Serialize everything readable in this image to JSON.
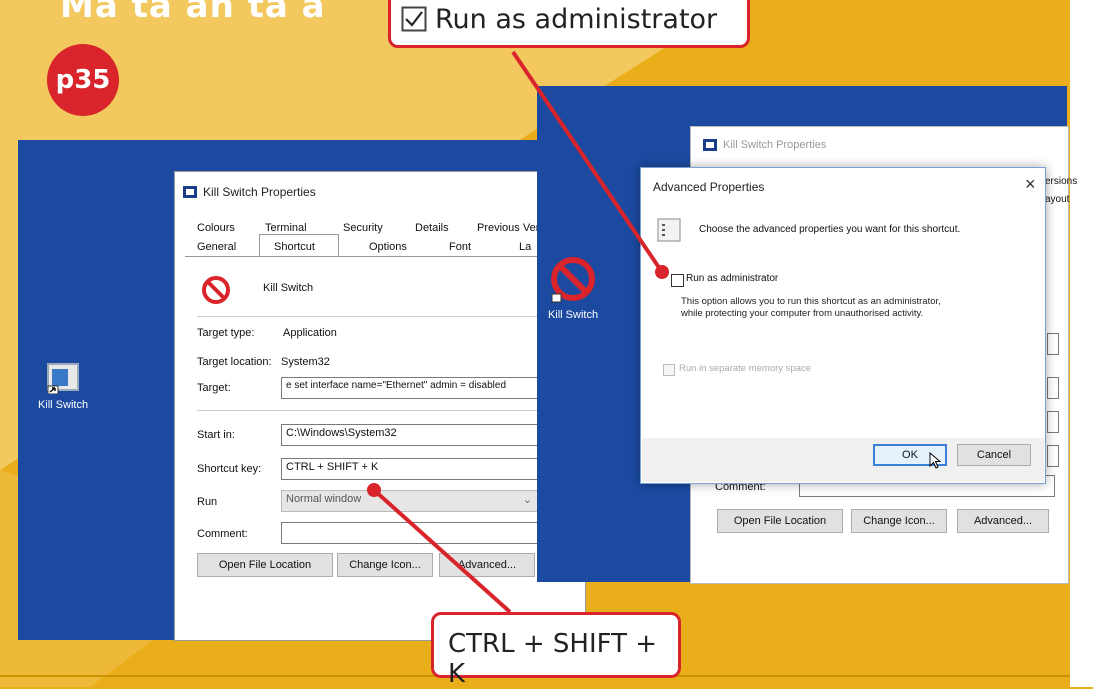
{
  "headline": "Ma ta an ta a",
  "page_badge": "p35",
  "callout_top": "Run as administrator",
  "callout_bottom": "CTRL + SHIFT + K",
  "left_desktop": {
    "icon_label": "Kill Switch"
  },
  "left_dialog": {
    "title": "Kill Switch Properties",
    "tabs_row1": [
      "Colours",
      "Terminal",
      "Security",
      "Details",
      "Previous Ver"
    ],
    "tabs_row2": [
      "General",
      "Shortcut",
      "Options",
      "Font",
      "La"
    ],
    "name": "Kill Switch",
    "target_type_label": "Target type:",
    "target_type": "Application",
    "target_location_label": "Target location:",
    "target_location": "System32",
    "target_label": "Target:",
    "target": "e set interface name=\"Ethernet\" admin = disabled",
    "start_in_label": "Start in:",
    "start_in": "C:\\Windows\\System32",
    "shortcut_key_label": "Shortcut key:",
    "shortcut_key": "CTRL + SHIFT + K",
    "run_label": "Run",
    "run": "Normal window",
    "comment_label": "Comment:",
    "comment": "",
    "btn_open": "Open File Location",
    "btn_icon": "Change Icon...",
    "btn_adv": "Advanced..."
  },
  "right_desktop": {
    "icon_label": "Kill Switch"
  },
  "right_dialog": {
    "title": "Kill Switch Properties",
    "tab_fragments": [
      "ersions",
      "ayout"
    ],
    "comment_label": "Comment:",
    "btn_open": "Open File Location",
    "btn_icon": "Change Icon...",
    "btn_adv": "Advanced..."
  },
  "advanced": {
    "title": "Advanced Properties",
    "close": "×",
    "intro": "Choose the advanced properties you want for this shortcut.",
    "run_admin": "Run as administrator",
    "desc": "This option allows you to run this shortcut as an administrator, while protecting your computer from unauthorised activity.",
    "separate_memory": "Run in separate memory space",
    "ok": "OK",
    "cancel": "Cancel"
  },
  "colors": {
    "accent_red": "#d8242a",
    "desktop_blue": "#1b4aa0",
    "background_yellow": "#e9ae1a"
  }
}
